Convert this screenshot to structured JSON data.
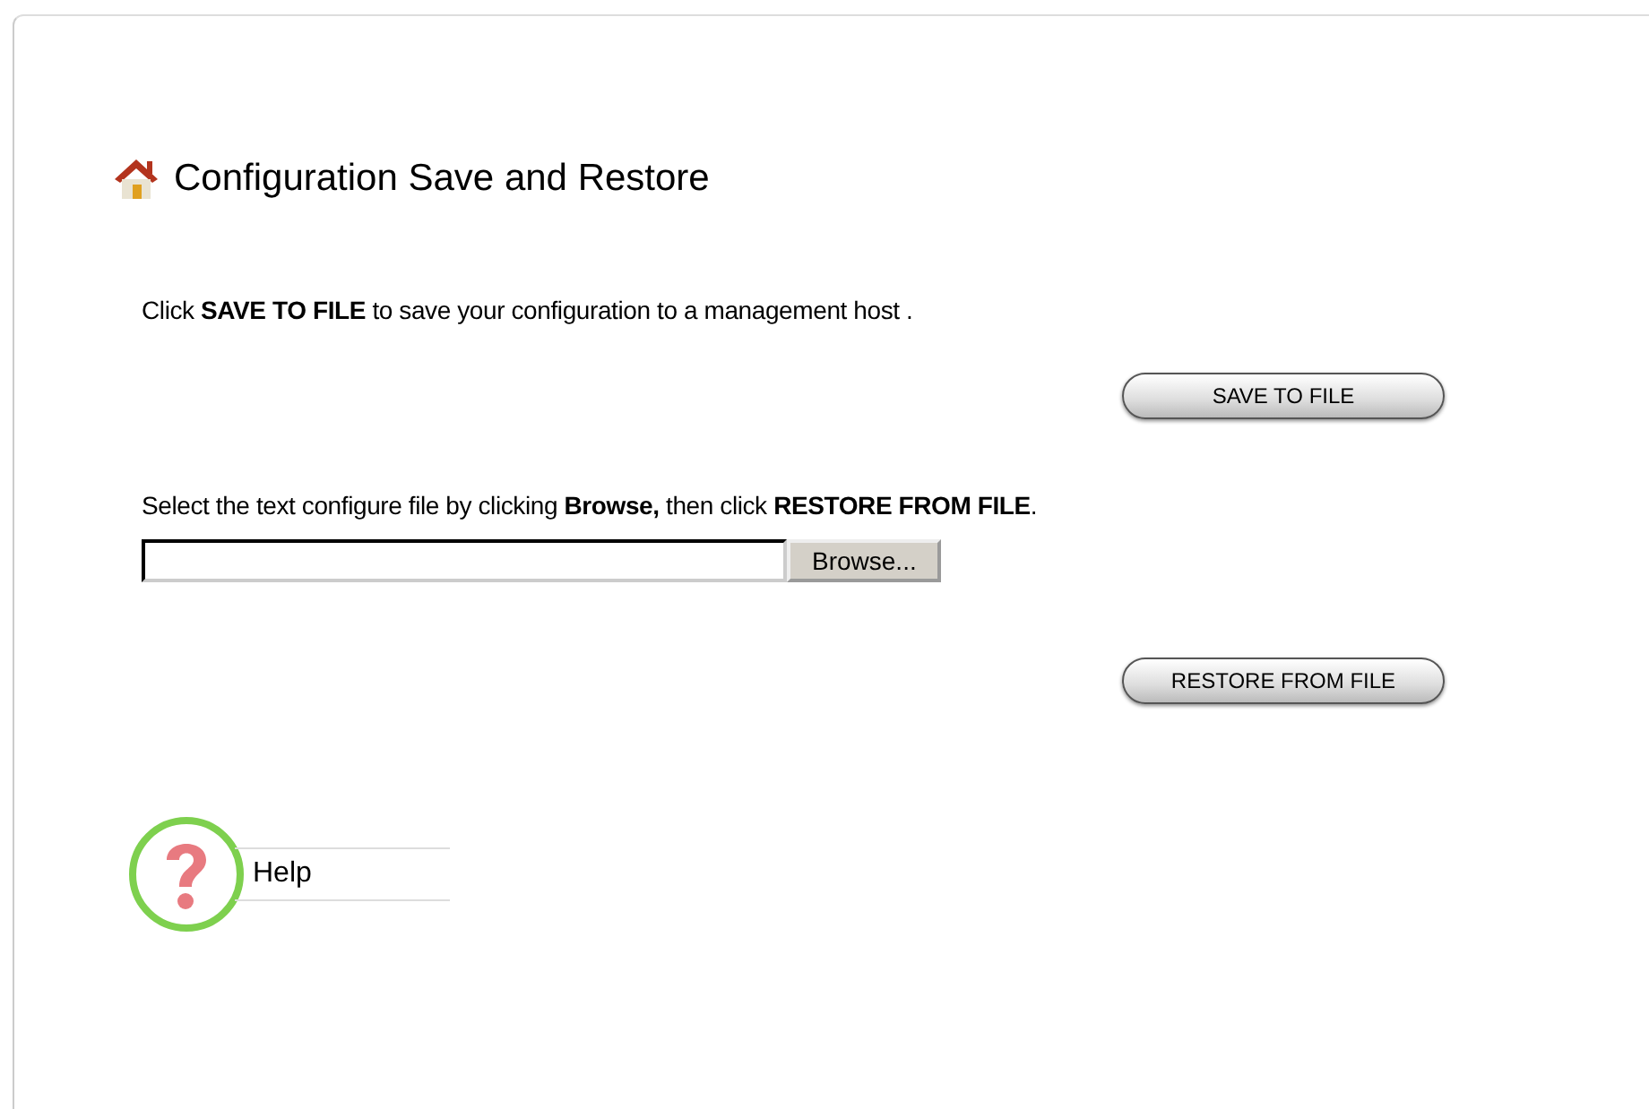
{
  "title": "Configuration Save and Restore",
  "save_section": {
    "instruction": "Click **SAVE TO FILE** to save your configuration to a management host .",
    "button": "SAVE TO FILE"
  },
  "restore_section": {
    "instruction": "Select the text configure file by clicking **Browse,** then click **RESTORE FROM FILE**.",
    "browse_button": "Browse...",
    "button": "RESTORE FROM FILE"
  },
  "help": {
    "label": "Help"
  }
}
